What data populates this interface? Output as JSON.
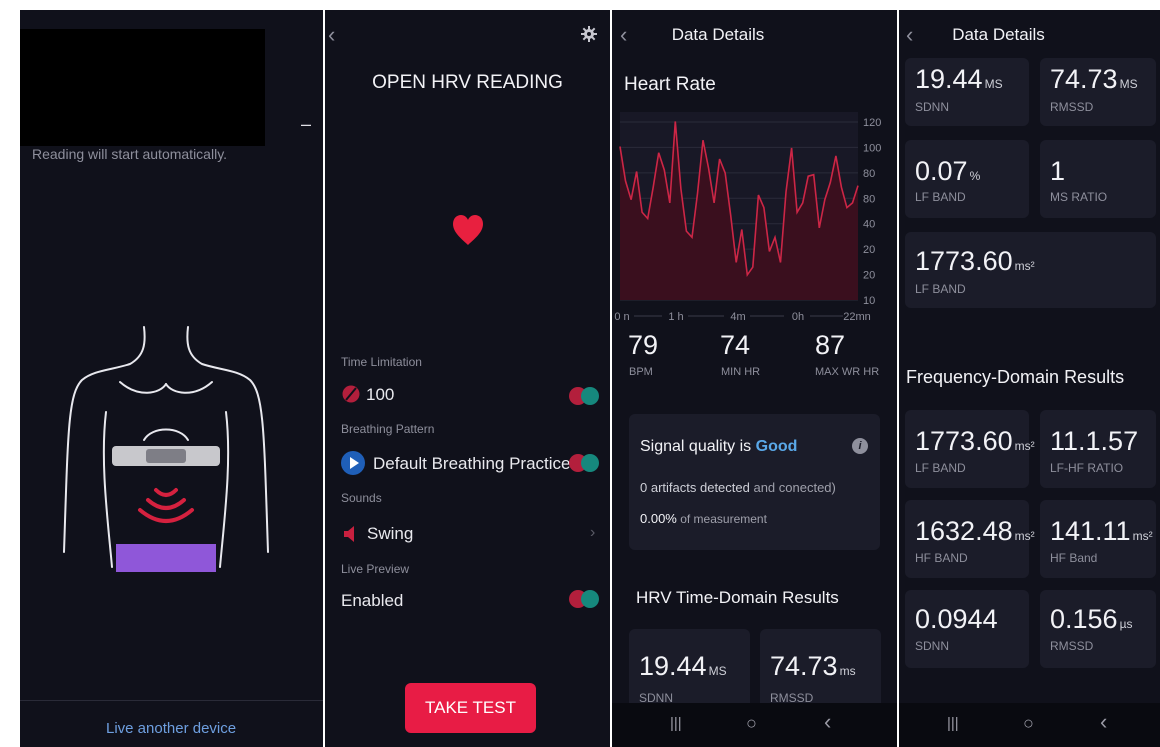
{
  "screen1": {
    "status_text": "Reading will start automatically.",
    "minimize_glyph": "–",
    "bottom_link": "Live another device",
    "colors": {
      "strap": "#c8c8cc",
      "waves": "#d5213f",
      "shorts": "#8f57d9"
    }
  },
  "screen2": {
    "back_icon": "chevron-left-icon",
    "settings_icon": "gear-icon",
    "title": "OPEN HRV READING",
    "heart_color": "#e8203f",
    "time_limitation": {
      "label": "Time Limitation",
      "value": "100"
    },
    "breathing_pattern": {
      "label": "Breathing Pattern",
      "value": "Default Breathing Practice"
    },
    "sounds": {
      "label": "Sounds",
      "value": "Swing"
    },
    "live_preview": {
      "label": "Live Preview",
      "value": "Enabled"
    },
    "take_test": "TAKE TEST"
  },
  "screen3": {
    "title": "Data Details",
    "section_heart_rate": "Heart Rate",
    "chart_data": {
      "type": "area",
      "title": "Heart Rate",
      "x_tick_labels": [
        "0 n",
        "1 h",
        "4m",
        "0h",
        "22mn"
      ],
      "y_tick_labels": [
        "120",
        "100",
        "80",
        "80",
        "40",
        "20",
        "20",
        "10"
      ],
      "values": [
        108,
        86,
        74,
        92,
        66,
        62,
        82,
        104,
        93,
        72,
        124,
        81,
        54,
        50,
        78,
        112,
        94,
        72,
        100,
        91,
        64,
        34,
        55,
        26,
        31,
        77,
        69,
        41,
        50,
        34,
        79,
        107,
        66,
        72,
        89,
        90,
        56,
        74,
        85,
        102,
        82,
        69,
        72,
        83
      ],
      "line_color": "#cc2646",
      "fill_color": "#3a0f1e"
    },
    "stats": [
      {
        "value": "79",
        "label": "BPM"
      },
      {
        "value": "74",
        "label": "MIN HR"
      },
      {
        "value": "87",
        "label": "MAX WR HR"
      }
    ],
    "signal": {
      "prefix": "Signal quality is ",
      "quality": "Good",
      "quality_color": "#5aa8e8",
      "artifacts_num": "0",
      "artifacts_text": "artifacts detected",
      "artifacts_tail": " and conected)",
      "pct": "0.00%",
      "pct_text": " of measurement"
    },
    "section_time_domain": "HRV Time-Domain Results",
    "time_cards": [
      {
        "value": "19.44",
        "unit": "MS",
        "label": "SDNN"
      },
      {
        "value": "74.73",
        "unit": "ms",
        "label": "RMSSD"
      }
    ]
  },
  "screen4": {
    "title": "Data Details",
    "cards_top": [
      {
        "value": "19.44",
        "unit": "MS",
        "label": "SDNN"
      },
      {
        "value": "74.73",
        "unit": "MS",
        "label": "RMSSD"
      },
      {
        "value": "0.07",
        "unit": "%",
        "label": "LF BAND"
      },
      {
        "value": "1",
        "unit": "",
        "label": "MS RATIO"
      }
    ],
    "card_wide": {
      "value": "1773.60",
      "unit": "ms²",
      "label": "LF BAND"
    },
    "section_freq": "Frequency-Domain Results",
    "freq_cards": [
      {
        "value": "1773.60",
        "unit": "ms²",
        "label": "LF BAND"
      },
      {
        "value": "11.1.57",
        "unit": "",
        "label": "LF-HF RATIO"
      },
      {
        "value": "1632.48",
        "unit": "ms²",
        "label": "HF BAND"
      },
      {
        "value": "141.11",
        "unit": "ms²",
        "label": "HF Band"
      },
      {
        "value": "0.0944",
        "unit": "",
        "label": "SDNN"
      },
      {
        "value": "0.156",
        "unit": "µs",
        "label": "RMSSD"
      }
    ]
  },
  "navbar": {
    "recent": "|||",
    "home": "○",
    "back": "‹"
  }
}
